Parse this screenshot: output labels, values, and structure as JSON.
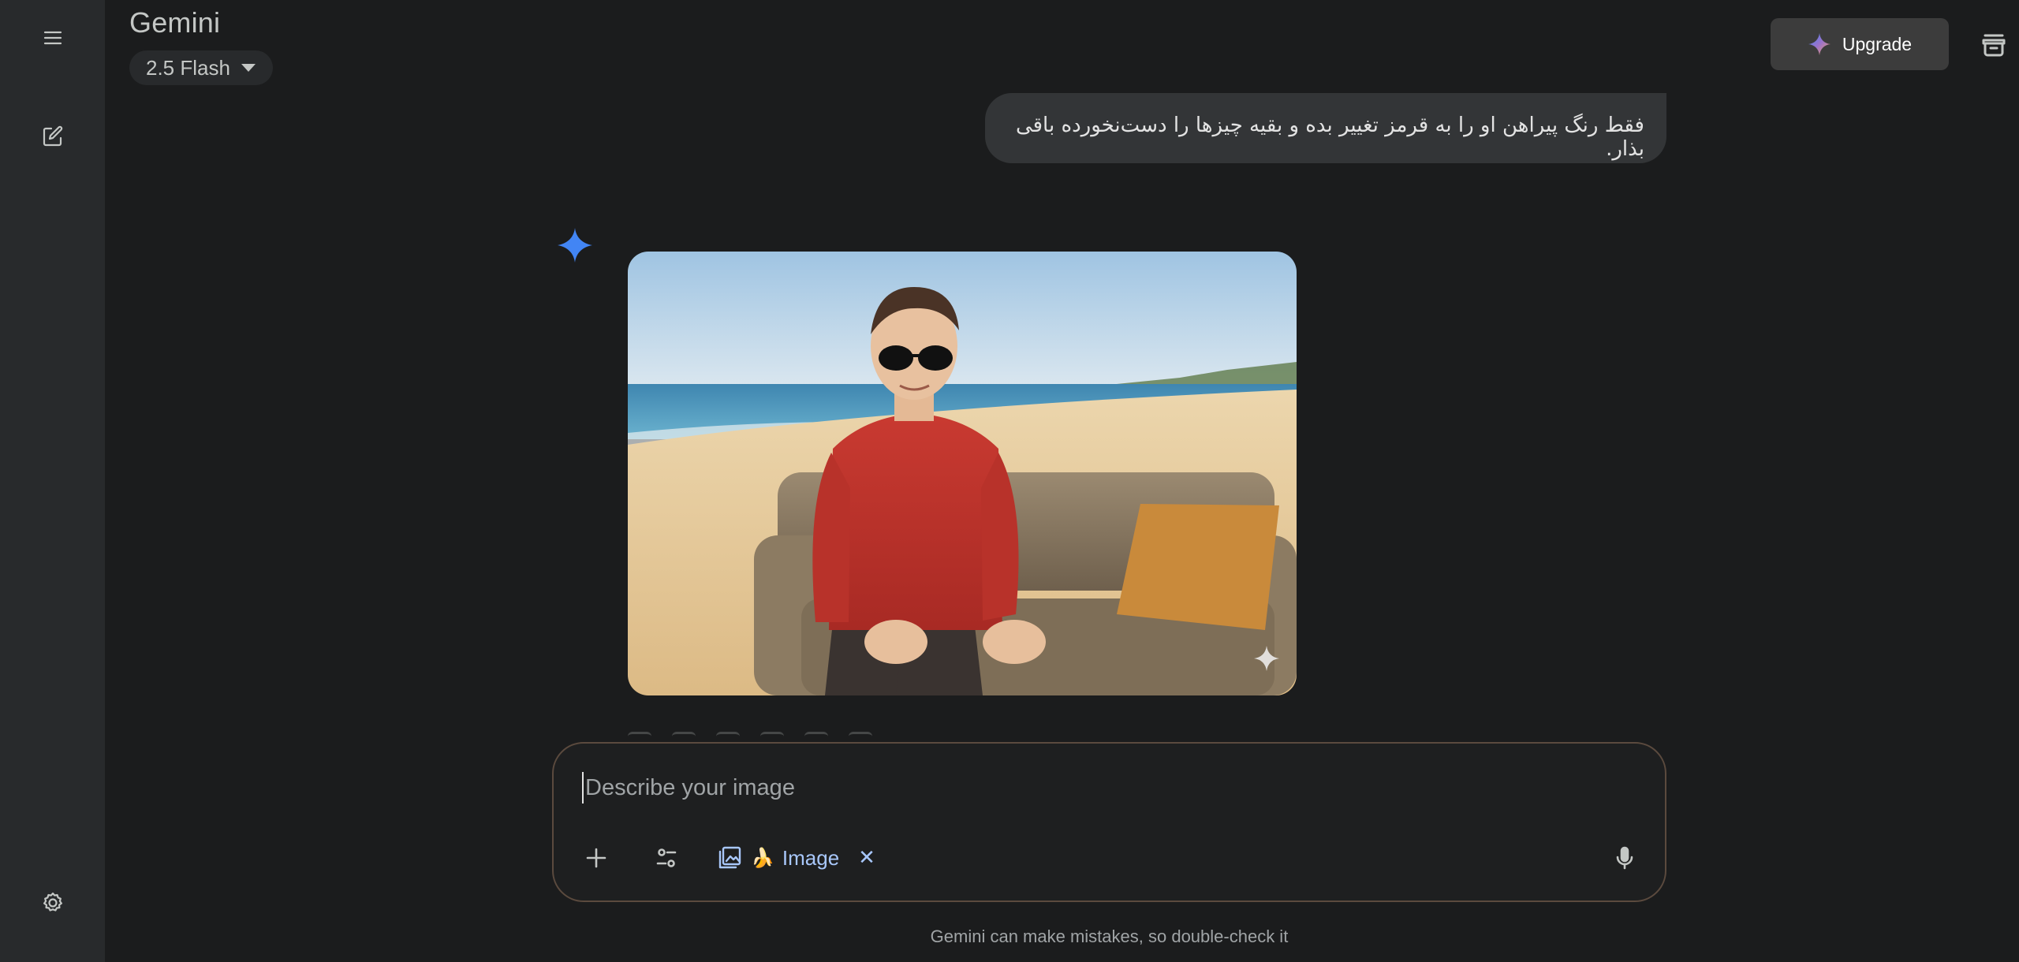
{
  "app": {
    "brand": "Gemini",
    "model": "2.5 Flash"
  },
  "header": {
    "upgrade_label": "Upgrade"
  },
  "sidebar": {
    "items": [
      {
        "name": "menu",
        "icon": "menu-icon"
      },
      {
        "name": "new-chat",
        "icon": "edit-icon"
      },
      {
        "name": "settings",
        "icon": "gear-icon"
      }
    ]
  },
  "conversation": {
    "user_message": "فقط رنگ پیراهن او را به قرمز تغییر بده و بقیه چیزها را دست‌نخورده باقی بذار.",
    "response": {
      "image_alt": "generated-image",
      "colors": {
        "shirt": "#c0312a",
        "sky_top": "#9fc4e2",
        "sea": "#4a8fb5",
        "sand": "#e7cc9f",
        "sofa": "#8b7a63",
        "pillow": "#c98a3b"
      }
    }
  },
  "input": {
    "placeholder": "Describe your image",
    "value": "",
    "chip_label": "Image",
    "chip_emoji": "🍌",
    "chip_close": "✕"
  },
  "footer": {
    "disclaimer": "Gemini can make mistakes, so double-check it"
  },
  "colors": {
    "background": "#1b1c1d",
    "sidebar": "#282a2c",
    "accent_blue": "#4285f4",
    "chip_blue": "#a8c7fa",
    "input_border": "#5b4a3e"
  }
}
